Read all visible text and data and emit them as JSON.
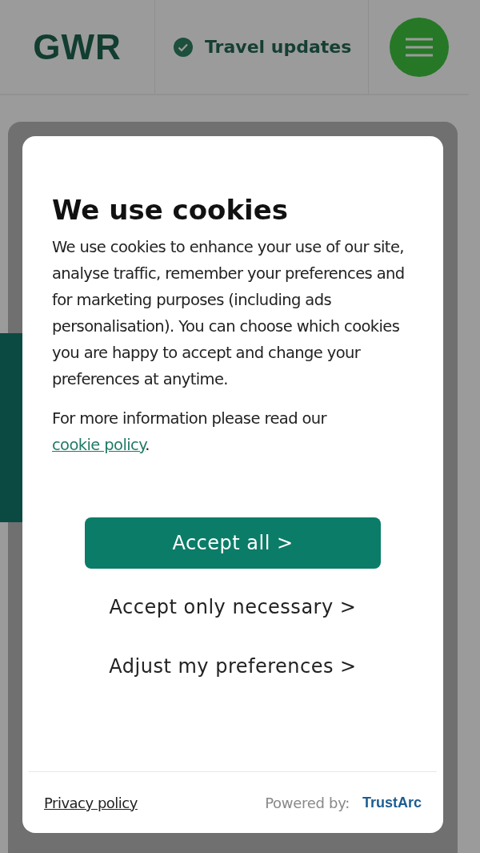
{
  "header": {
    "logo": "GWR",
    "travel_updates": "Travel updates"
  },
  "cookie_dialog": {
    "title": "We use cookies",
    "body": "We use cookies to enhance your use of our site, analyse traffic, remember your preferences and for marketing purposes (including ads personalisation). You can choose which cookies you are happy to accept and change your preferences at anytime.",
    "more_info": "For more information please read our",
    "policy_link": "cookie policy",
    "policy_end": ".",
    "buttons": [
      {
        "label": "Accept all >",
        "kind": "primary"
      },
      {
        "label": "Accept only necessary >",
        "kind": "plain"
      },
      {
        "label": "Adjust my preferences >",
        "kind": "plain"
      }
    ],
    "footer": {
      "privacy_link": "Privacy policy",
      "powered_by": "Powered by:",
      "brand": "TrustArc"
    }
  }
}
